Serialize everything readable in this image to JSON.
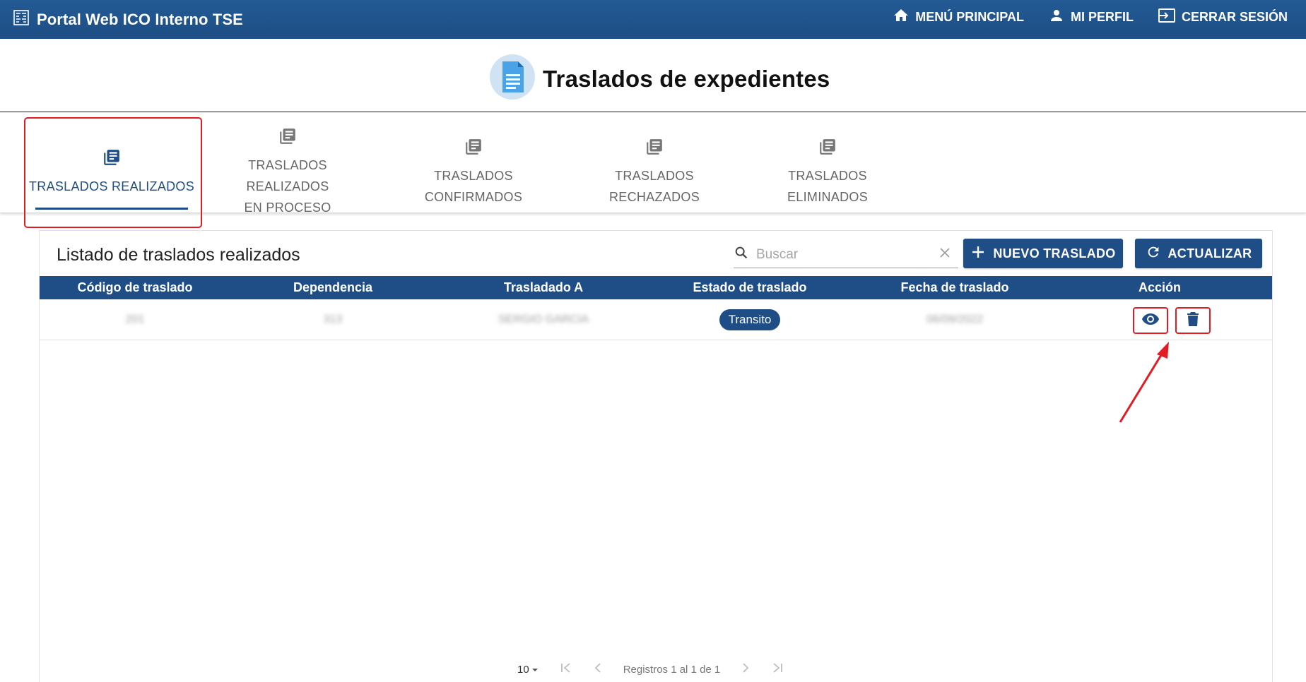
{
  "app": {
    "title": "Portal Web ICO Interno TSE",
    "logo_icon": "tse-logo-icon",
    "nav": [
      {
        "label": "MENÚ PRINCIPAL",
        "icon": "home-icon"
      },
      {
        "label": "MI PERFIL",
        "icon": "person-icon"
      },
      {
        "label": "CERRAR SESIÓN",
        "icon": "logout-icon"
      }
    ]
  },
  "page": {
    "title": "Traslados de expedientes",
    "icon": "document-icon"
  },
  "tabs": [
    {
      "label": "TRASLADOS REALIZADOS",
      "active": true
    },
    {
      "label_line1": "TRASLADOS REALIZADOS",
      "label_line2": "EN PROCESO",
      "active": false
    },
    {
      "label": "TRASLADOS CONFIRMADOS",
      "active": false
    },
    {
      "label": "TRASLADOS RECHAZADOS",
      "active": false
    },
    {
      "label": "TRASLADOS ELIMINADOS",
      "active": false
    }
  ],
  "list": {
    "title": "Listado de traslados realizados",
    "search_placeholder": "Buscar",
    "new_button": "NUEVO TRASLADO",
    "refresh_button": "ACTUALIZAR",
    "columns": [
      "Código de traslado",
      "Dependencia",
      "Trasladado A",
      "Estado de traslado",
      "Fecha de traslado",
      "Acción"
    ],
    "rows": [
      {
        "codigo": "201",
        "dependencia": "313",
        "trasladado_a": "SERGIO GARCIA",
        "estado": "Transito",
        "fecha": "06/09/2022",
        "acciones": [
          "eye-icon",
          "trash-icon"
        ]
      }
    ]
  },
  "pagination": {
    "page_size": "10",
    "summary": "Registros 1 al 1 de 1"
  },
  "colors": {
    "primary": "#1e4e85",
    "annotation": "#e31b23"
  }
}
